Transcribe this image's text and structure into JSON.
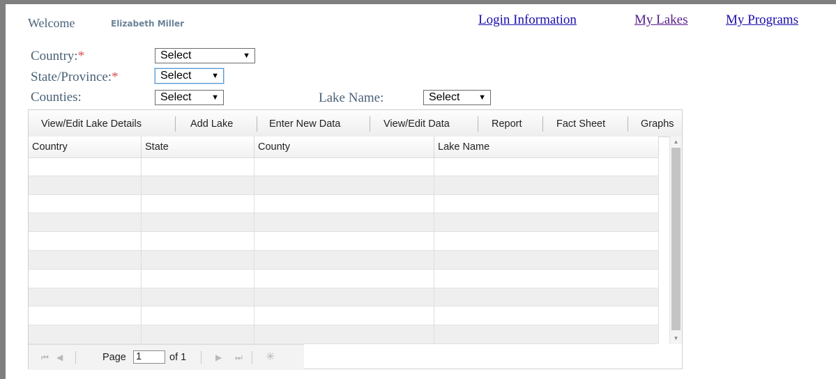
{
  "header": {
    "welcome": "Welcome",
    "user_name": "Elizabeth Miller",
    "nav": {
      "login": "Login Information",
      "lakes": "My Lakes",
      "programs": "My Programs"
    }
  },
  "filters": {
    "country": {
      "label": "Country:",
      "required_mark": "*",
      "value": "Select"
    },
    "state": {
      "label": "State/Province:",
      "required_mark": "*",
      "value": "Select"
    },
    "counties": {
      "label": "Counties:",
      "value": "Select"
    },
    "lake_name": {
      "label": "Lake Name:",
      "value": "Select"
    }
  },
  "toolbar": {
    "items": [
      "View/Edit Lake Details",
      "Add Lake",
      "Enter New Data",
      "View/Edit Data",
      "Report",
      "Fact Sheet",
      "Graphs"
    ]
  },
  "table": {
    "columns": [
      "Country",
      "State",
      "County",
      "Lake Name"
    ],
    "rows": []
  },
  "pager": {
    "page_label": "Page",
    "current_page": "1",
    "of_label": "of 1"
  },
  "colors": {
    "label": "#4a6177",
    "required": "#d9534f",
    "link": "#1a0dab",
    "visited_link": "#551a8b",
    "alt_row": "#efefef"
  },
  "icons": [
    "first-page-icon",
    "prev-page-icon",
    "next-page-icon",
    "last-page-icon",
    "loading-icon",
    "dropdown-arrow-icon",
    "scroll-up-icon",
    "scroll-down-icon"
  ]
}
